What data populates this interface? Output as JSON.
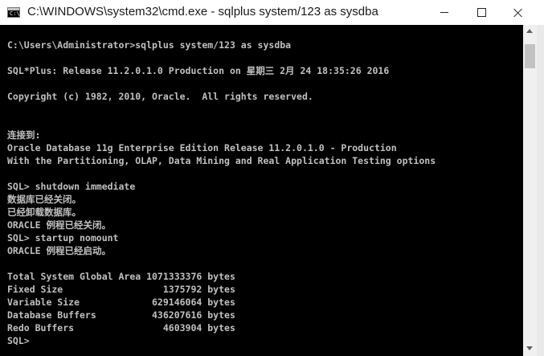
{
  "window": {
    "title": "C:\\WINDOWS\\system32\\cmd.exe - sqlplus  system/123 as sysdba",
    "icon_prompt": "C:\\"
  },
  "console": {
    "lines": [
      "C:\\Users\\Administrator>sqlplus system/123 as sysdba",
      "",
      "SQL*Plus: Release 11.2.0.1.0 Production on 星期三 2月 24 18:35:26 2016",
      "",
      "Copyright (c) 1982, 2010, Oracle.  All rights reserved.",
      "",
      "",
      "连接到:",
      "Oracle Database 11g Enterprise Edition Release 11.2.0.1.0 - Production",
      "With the Partitioning, OLAP, Data Mining and Real Application Testing options",
      "",
      "SQL> shutdown immediate",
      "数据库已经关闭。",
      "已经卸载数据库。",
      "ORACLE 例程已经关闭。",
      "SQL> startup nomount",
      "ORACLE 例程已经启动。",
      "",
      "Total System Global Area 1071333376 bytes",
      "Fixed Size                  1375792 bytes",
      "Variable Size             629146064 bytes",
      "Database Buffers          436207616 bytes",
      "Redo Buffers                4603904 bytes",
      "SQL>"
    ]
  },
  "colors": {
    "console_bg": "#000000",
    "console_text": "#c0c0c0",
    "titlebar_bg": "#ffffff"
  },
  "icons": {
    "app": "cmd-icon",
    "minimize": "minimize-icon",
    "maximize": "maximize-icon",
    "close": "close-icon"
  }
}
